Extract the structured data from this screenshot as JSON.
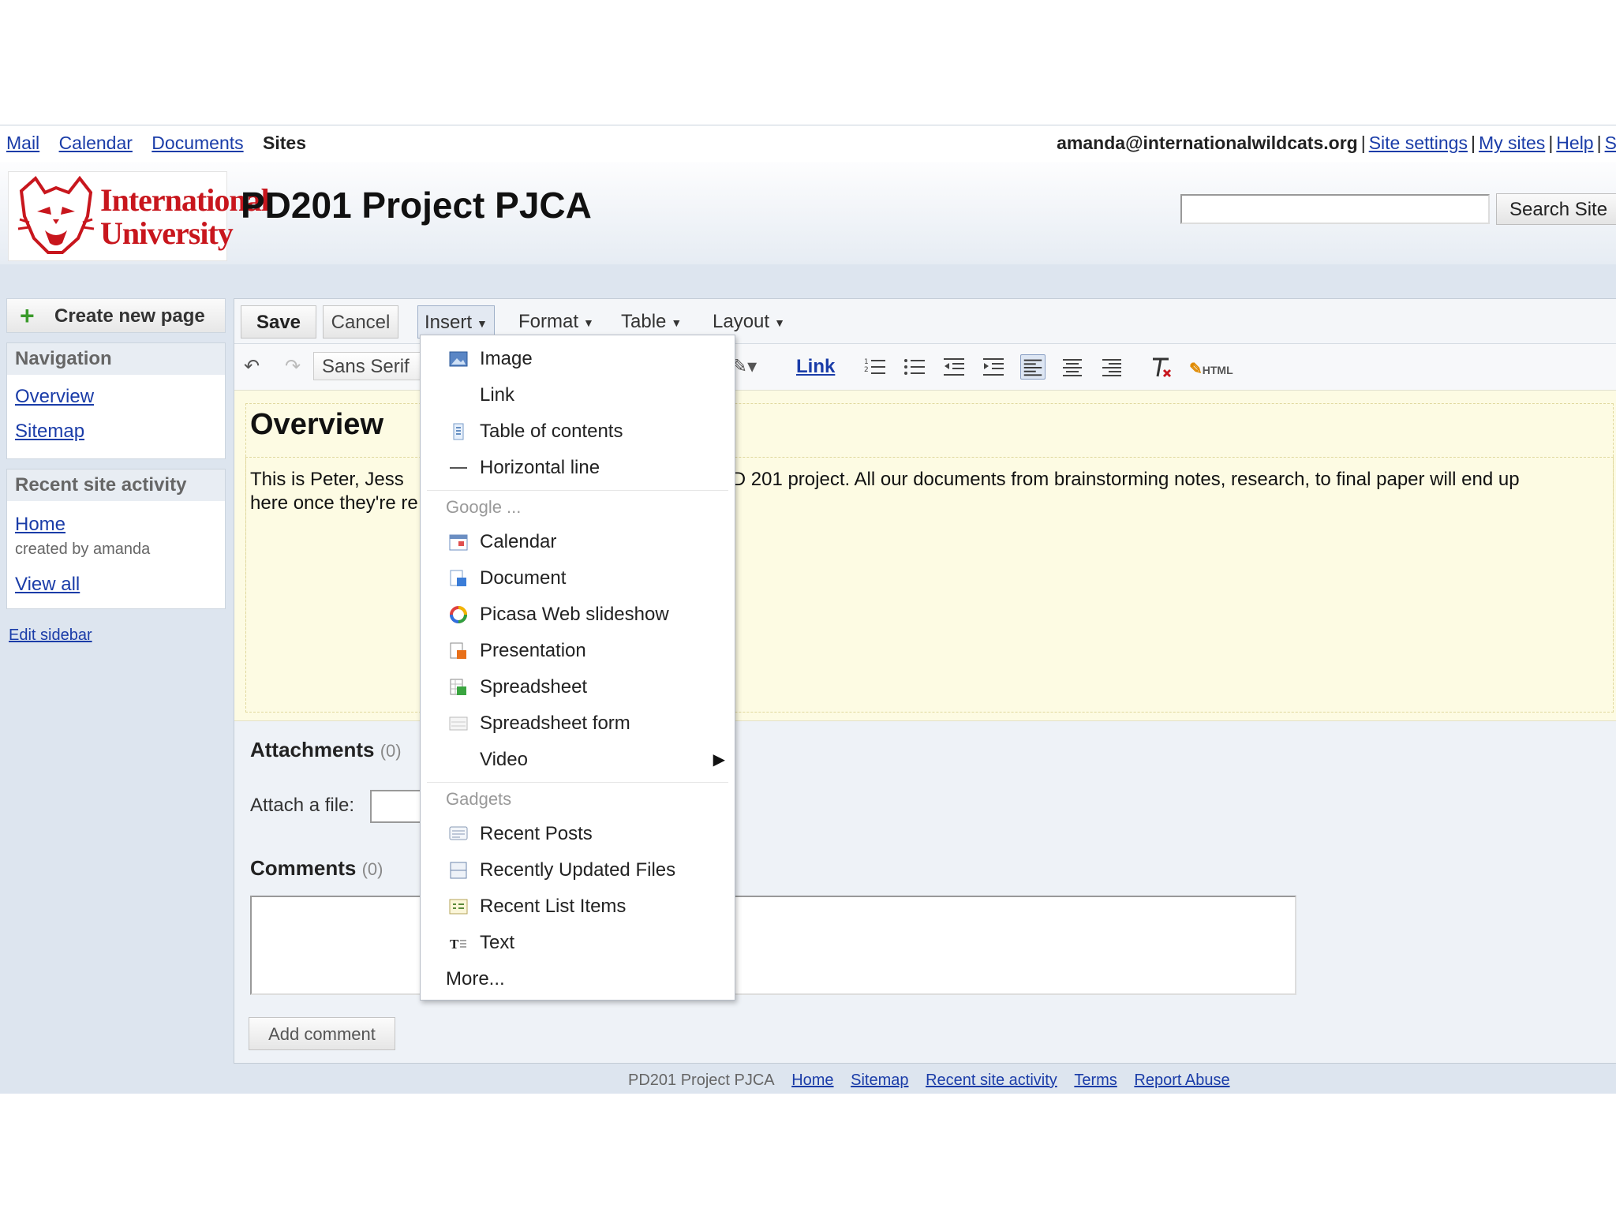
{
  "topbar": {
    "links": [
      "Mail",
      "Calendar",
      "Documents"
    ],
    "current": "Sites",
    "email": "amanda@internationalwildcats.org",
    "right_links": [
      "Site settings",
      "My sites",
      "Help",
      "Sign out"
    ],
    "separator": "|"
  },
  "header": {
    "logo_line1": "International",
    "logo_line2": "University",
    "site_title": "PD201 Project PJCA",
    "search_button": "Search Site",
    "search_value": ""
  },
  "sidebar": {
    "create_page": "Create new page",
    "navigation_title": "Navigation",
    "nav_items": [
      "Overview",
      "Sitemap"
    ],
    "activity_title": "Recent site activity",
    "activity_item": "Home",
    "activity_meta": "created by amanda",
    "view_all": "View all",
    "edit_sidebar": "Edit sidebar"
  },
  "editor": {
    "save": "Save",
    "cancel": "Cancel",
    "menus": [
      "Insert",
      "Format",
      "Table",
      "Layout"
    ],
    "font": "Sans Serif",
    "link": "Link",
    "html_label": "HTML",
    "page_heading": "Overview",
    "body_left": "This is Peter, Jess",
    "body_right": "PD 201 project. All our documents from brainstorming notes, research, to final paper will end up",
    "body_line2": "here once they're re",
    "attachments_label": "Attachments",
    "attachments_count": "(0)",
    "attach_file_label": "Attach a file:",
    "comments_label": "Comments",
    "comments_count": "(0)",
    "add_comment": "Add comment"
  },
  "insert_menu": {
    "items_top": [
      {
        "label": "Image",
        "icon": "image-icon"
      },
      {
        "label": "Link",
        "icon": ""
      },
      {
        "label": "Table of contents",
        "icon": "toc-icon"
      },
      {
        "label": "Horizontal line",
        "icon": "hr-icon"
      }
    ],
    "google_header": "Google ...",
    "google_items": [
      {
        "label": "Calendar",
        "icon": "calendar-icon"
      },
      {
        "label": "Document",
        "icon": "document-icon"
      },
      {
        "label": "Picasa Web slideshow",
        "icon": "picasa-icon"
      },
      {
        "label": "Presentation",
        "icon": "presentation-icon"
      },
      {
        "label": "Spreadsheet",
        "icon": "spreadsheet-icon"
      },
      {
        "label": "Spreadsheet form",
        "icon": "form-icon"
      },
      {
        "label": "Video",
        "icon": ""
      }
    ],
    "gadgets_header": "Gadgets",
    "gadget_items": [
      {
        "label": "Recent Posts",
        "icon": "recent-posts-icon"
      },
      {
        "label": "Recently Updated Files",
        "icon": "files-icon"
      },
      {
        "label": "Recent List Items",
        "icon": "list-items-icon"
      },
      {
        "label": "Text",
        "icon": "text-gadget-icon"
      }
    ],
    "more": "More..."
  },
  "footer": {
    "site_name": "PD201 Project PJCA",
    "links": [
      "Home",
      "Sitemap",
      "Recent site activity",
      "Terms",
      "Report Abuse"
    ]
  },
  "colors": {
    "link": "#1a3ca8",
    "content_bg": "#fdfbe3",
    "page_bg": "#dde5ef",
    "logo_red": "#c8161d"
  }
}
